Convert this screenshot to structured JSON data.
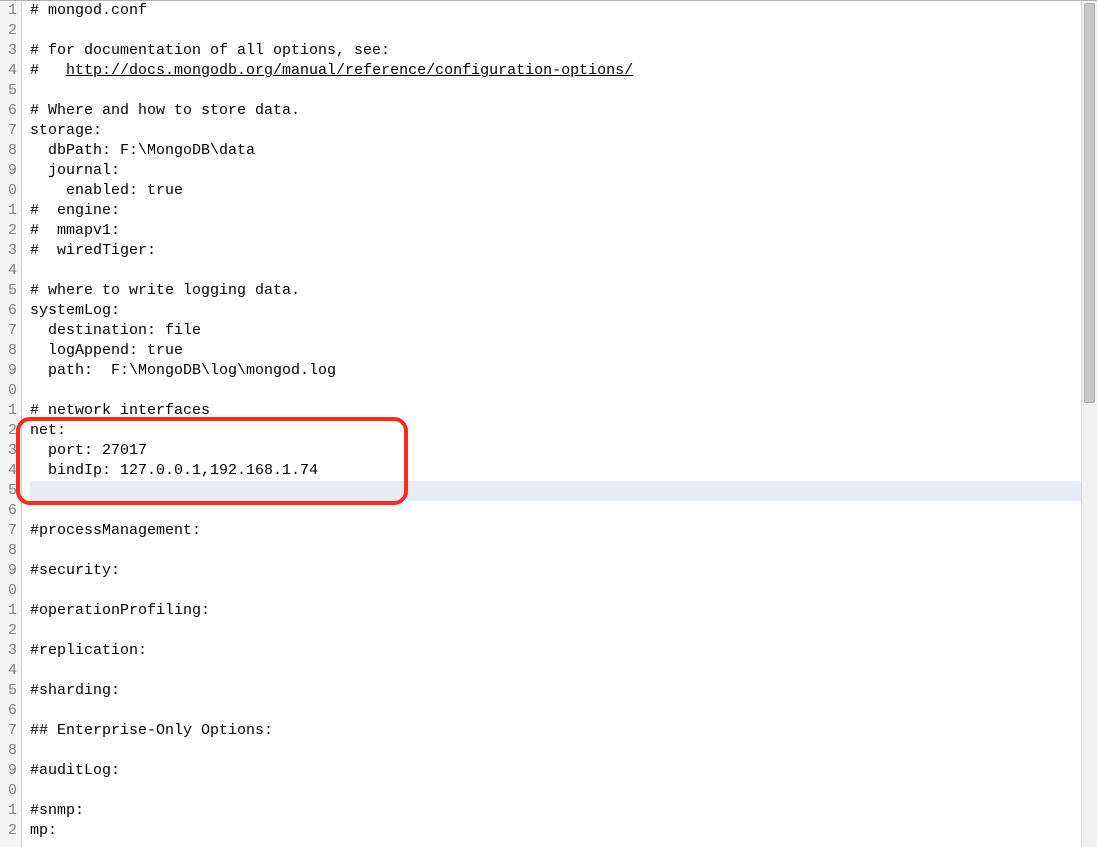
{
  "editor": {
    "current_line_index": 24,
    "highlight": {
      "start_line_index": 21,
      "end_line_index": 24
    },
    "lines": [
      {
        "num": "1",
        "type": "plain",
        "text": "# mongod.conf"
      },
      {
        "num": "2",
        "type": "plain",
        "text": ""
      },
      {
        "num": "3",
        "type": "plain",
        "text": "# for documentation of all options, see:"
      },
      {
        "num": "4",
        "type": "link",
        "prefix": "#   ",
        "link_text": "http://docs.mongodb.org/manual/reference/configuration-options/"
      },
      {
        "num": "5",
        "type": "plain",
        "text": ""
      },
      {
        "num": "6",
        "type": "plain",
        "text": "# Where and how to store data."
      },
      {
        "num": "7",
        "type": "plain",
        "text": "storage:"
      },
      {
        "num": "8",
        "type": "plain",
        "text": "  dbPath: F:\\MongoDB\\data"
      },
      {
        "num": "9",
        "type": "plain",
        "text": "  journal:"
      },
      {
        "num": "0",
        "type": "plain",
        "text": "    enabled: true"
      },
      {
        "num": "1",
        "type": "plain",
        "text": "#  engine:"
      },
      {
        "num": "2",
        "type": "plain",
        "text": "#  mmapv1:"
      },
      {
        "num": "3",
        "type": "plain",
        "text": "#  wiredTiger:"
      },
      {
        "num": "4",
        "type": "plain",
        "text": ""
      },
      {
        "num": "5",
        "type": "plain",
        "text": "# where to write logging data."
      },
      {
        "num": "6",
        "type": "plain",
        "text": "systemLog:"
      },
      {
        "num": "7",
        "type": "plain",
        "text": "  destination: file"
      },
      {
        "num": "8",
        "type": "plain",
        "text": "  logAppend: true"
      },
      {
        "num": "9",
        "type": "plain",
        "text": "  path:  F:\\MongoDB\\log\\mongod.log"
      },
      {
        "num": "0",
        "type": "plain",
        "text": ""
      },
      {
        "num": "1",
        "type": "plain",
        "text": "# network interfaces"
      },
      {
        "num": "2",
        "type": "plain",
        "text": "net:"
      },
      {
        "num": "3",
        "type": "plain",
        "text": "  port: 27017"
      },
      {
        "num": "4",
        "type": "plain",
        "text": "  bindIp: 127.0.0.1,192.168.1.74"
      },
      {
        "num": "5",
        "type": "plain",
        "text": ""
      },
      {
        "num": "6",
        "type": "plain",
        "text": ""
      },
      {
        "num": "7",
        "type": "plain",
        "text": "#processManagement:"
      },
      {
        "num": "8",
        "type": "plain",
        "text": ""
      },
      {
        "num": "9",
        "type": "plain",
        "text": "#security:"
      },
      {
        "num": "0",
        "type": "plain",
        "text": ""
      },
      {
        "num": "1",
        "type": "plain",
        "text": "#operationProfiling:"
      },
      {
        "num": "2",
        "type": "plain",
        "text": ""
      },
      {
        "num": "3",
        "type": "plain",
        "text": "#replication:"
      },
      {
        "num": "4",
        "type": "plain",
        "text": ""
      },
      {
        "num": "5",
        "type": "plain",
        "text": "#sharding:"
      },
      {
        "num": "6",
        "type": "plain",
        "text": ""
      },
      {
        "num": "7",
        "type": "plain",
        "text": "## Enterprise-Only Options:"
      },
      {
        "num": "8",
        "type": "plain",
        "text": ""
      },
      {
        "num": "9",
        "type": "plain",
        "text": "#auditLog:"
      },
      {
        "num": "0",
        "type": "plain",
        "text": ""
      },
      {
        "num": "1",
        "type": "plain",
        "text": "#snmp:"
      },
      {
        "num": "2",
        "type": "plain",
        "text": "mp:"
      }
    ]
  }
}
